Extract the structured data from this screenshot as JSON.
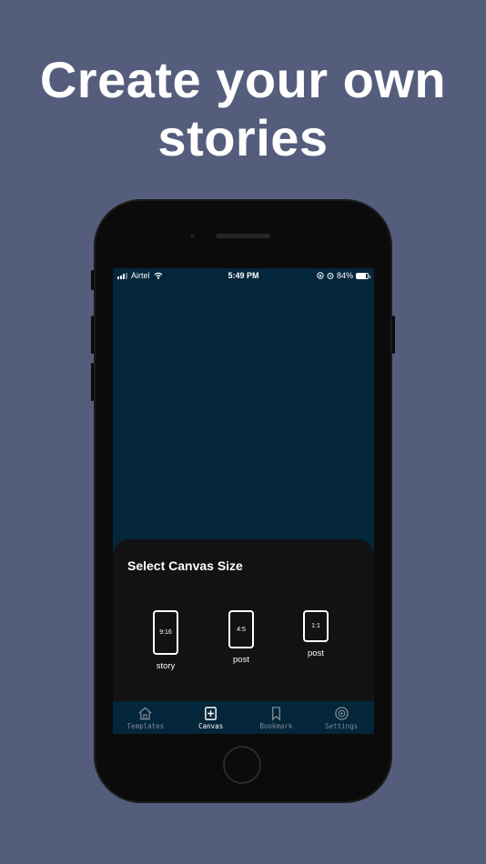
{
  "headline": {
    "line1": "Create your own",
    "line2": "stories"
  },
  "status_bar": {
    "carrier": "Airtel",
    "time": "5:49 PM",
    "battery": "84%",
    "battery_level": 0.84
  },
  "sheet": {
    "title": "Select Canvas Size",
    "options": [
      {
        "ratio": "9:16",
        "label": "story"
      },
      {
        "ratio": "4:5",
        "label": "post"
      },
      {
        "ratio": "1:1",
        "label": "post"
      }
    ]
  },
  "tabs": [
    {
      "label": "Templates",
      "icon": "home-icon",
      "active": false
    },
    {
      "label": "Canvas",
      "icon": "plus-square-icon",
      "active": true
    },
    {
      "label": "Bookmark",
      "icon": "bookmark-icon",
      "active": false
    },
    {
      "label": "Settings",
      "icon": "settings-icon",
      "active": false
    }
  ],
  "colors": {
    "background": "#555d7c",
    "screen": "#04263b",
    "sheet": "#121212",
    "tabbar": "#03263a"
  }
}
